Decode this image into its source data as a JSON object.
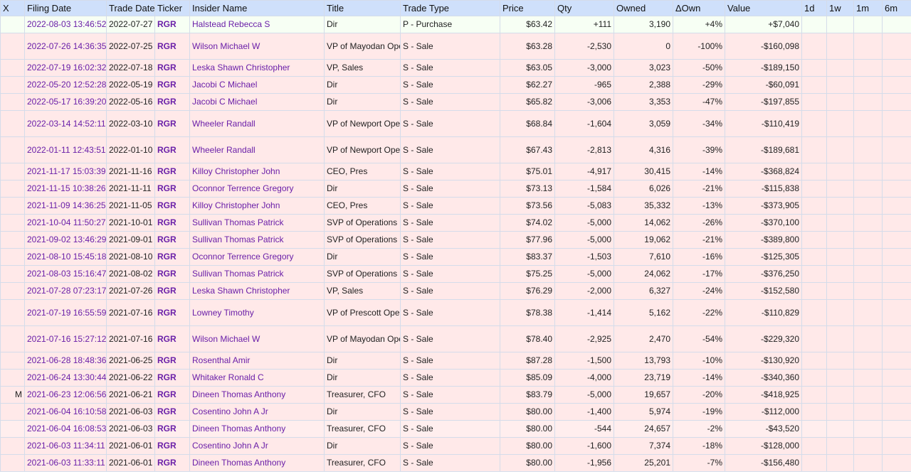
{
  "table": {
    "columns": [
      "X",
      "Filing Date",
      "Trade Date",
      "Ticker",
      "Insider Name",
      "Title",
      "Trade Type",
      "Price",
      "Qty",
      "Owned",
      "ΔOwn",
      "Value",
      "1d",
      "1w",
      "1m",
      "6m"
    ],
    "rows": [
      {
        "x": "",
        "filing_date": "2022-08-03 13:46:52",
        "trade_date": "2022-07-27",
        "ticker": "RGR",
        "insider": "Halstead Rebecca S",
        "title": "Dir",
        "trade_type": "P - Purchase",
        "price": "$63.42",
        "qty": "+111",
        "owned": "3,190",
        "d_own": "+4%",
        "value": "+$7,040",
        "d1": "",
        "w1": "",
        "m1": "",
        "m6": "",
        "kind": "purchase"
      },
      {
        "x": "",
        "filing_date": "2022-07-26 14:36:35",
        "trade_date": "2022-07-25",
        "ticker": "RGR",
        "insider": "Wilson Michael W",
        "title": "VP of Mayodan Operations",
        "trade_type": "S - Sale",
        "price": "$63.28",
        "qty": "-2,530",
        "owned": "0",
        "d_own": "-100%",
        "value": "-$160,098",
        "d1": "",
        "w1": "",
        "m1": "",
        "m6": "",
        "kind": "sale"
      },
      {
        "x": "",
        "filing_date": "2022-07-19 16:02:32",
        "trade_date": "2022-07-18",
        "ticker": "RGR",
        "insider": "Leska Shawn Christopher",
        "title": "VP, Sales",
        "trade_type": "S - Sale",
        "price": "$63.05",
        "qty": "-3,000",
        "owned": "3,023",
        "d_own": "-50%",
        "value": "-$189,150",
        "d1": "",
        "w1": "",
        "m1": "",
        "m6": "",
        "kind": "sale"
      },
      {
        "x": "",
        "filing_date": "2022-05-20 12:52:28",
        "trade_date": "2022-05-19",
        "ticker": "RGR",
        "insider": "Jacobi C Michael",
        "title": "Dir",
        "trade_type": "S - Sale",
        "price": "$62.27",
        "qty": "-965",
        "owned": "2,388",
        "d_own": "-29%",
        "value": "-$60,091",
        "d1": "",
        "w1": "",
        "m1": "",
        "m6": "",
        "kind": "sale"
      },
      {
        "x": "",
        "filing_date": "2022-05-17 16:39:20",
        "trade_date": "2022-05-16",
        "ticker": "RGR",
        "insider": "Jacobi C Michael",
        "title": "Dir",
        "trade_type": "S - Sale",
        "price": "$65.82",
        "qty": "-3,006",
        "owned": "3,353",
        "d_own": "-47%",
        "value": "-$197,855",
        "d1": "",
        "w1": "",
        "m1": "",
        "m6": "",
        "kind": "sale"
      },
      {
        "x": "",
        "filing_date": "2022-03-14 14:52:11",
        "trade_date": "2022-03-10",
        "ticker": "RGR",
        "insider": "Wheeler Randall",
        "title": "VP of Newport Operations",
        "trade_type": "S - Sale",
        "price": "$68.84",
        "qty": "-1,604",
        "owned": "3,059",
        "d_own": "-34%",
        "value": "-$110,419",
        "d1": "",
        "w1": "",
        "m1": "",
        "m6": "",
        "kind": "sale"
      },
      {
        "x": "",
        "filing_date": "2022-01-11 12:43:51",
        "trade_date": "2022-01-10",
        "ticker": "RGR",
        "insider": "Wheeler Randall",
        "title": "VP of Newport Operations",
        "trade_type": "S - Sale",
        "price": "$67.43",
        "qty": "-2,813",
        "owned": "4,316",
        "d_own": "-39%",
        "value": "-$189,681",
        "d1": "",
        "w1": "",
        "m1": "",
        "m6": "",
        "kind": "sale"
      },
      {
        "x": "",
        "filing_date": "2021-11-17 15:03:39",
        "trade_date": "2021-11-16",
        "ticker": "RGR",
        "insider": "Killoy Christopher John",
        "title": "CEO, Pres",
        "trade_type": "S - Sale",
        "price": "$75.01",
        "qty": "-4,917",
        "owned": "30,415",
        "d_own": "-14%",
        "value": "-$368,824",
        "d1": "",
        "w1": "",
        "m1": "",
        "m6": "",
        "kind": "sale"
      },
      {
        "x": "",
        "filing_date": "2021-11-15 10:38:26",
        "trade_date": "2021-11-11",
        "ticker": "RGR",
        "insider": "Oconnor Terrence Gregory",
        "title": "Dir",
        "trade_type": "S - Sale",
        "price": "$73.13",
        "qty": "-1,584",
        "owned": "6,026",
        "d_own": "-21%",
        "value": "-$115,838",
        "d1": "",
        "w1": "",
        "m1": "",
        "m6": "",
        "kind": "sale"
      },
      {
        "x": "",
        "filing_date": "2021-11-09 14:36:25",
        "trade_date": "2021-11-05",
        "ticker": "RGR",
        "insider": "Killoy Christopher John",
        "title": "CEO, Pres",
        "trade_type": "S - Sale",
        "price": "$73.56",
        "qty": "-5,083",
        "owned": "35,332",
        "d_own": "-13%",
        "value": "-$373,905",
        "d1": "",
        "w1": "",
        "m1": "",
        "m6": "",
        "kind": "sale"
      },
      {
        "x": "",
        "filing_date": "2021-10-04 11:50:27",
        "trade_date": "2021-10-01",
        "ticker": "RGR",
        "insider": "Sullivan Thomas Patrick",
        "title": "SVP of Operations",
        "trade_type": "S - Sale",
        "price": "$74.02",
        "qty": "-5,000",
        "owned": "14,062",
        "d_own": "-26%",
        "value": "-$370,100",
        "d1": "",
        "w1": "",
        "m1": "",
        "m6": "",
        "kind": "sale"
      },
      {
        "x": "",
        "filing_date": "2021-09-02 13:46:29",
        "trade_date": "2021-09-01",
        "ticker": "RGR",
        "insider": "Sullivan Thomas Patrick",
        "title": "SVP of Operations",
        "trade_type": "S - Sale",
        "price": "$77.96",
        "qty": "-5,000",
        "owned": "19,062",
        "d_own": "-21%",
        "value": "-$389,800",
        "d1": "",
        "w1": "",
        "m1": "",
        "m6": "",
        "kind": "sale"
      },
      {
        "x": "",
        "filing_date": "2021-08-10 15:45:18",
        "trade_date": "2021-08-10",
        "ticker": "RGR",
        "insider": "Oconnor Terrence Gregory",
        "title": "Dir",
        "trade_type": "S - Sale",
        "price": "$83.37",
        "qty": "-1,503",
        "owned": "7,610",
        "d_own": "-16%",
        "value": "-$125,305",
        "d1": "",
        "w1": "",
        "m1": "",
        "m6": "",
        "kind": "sale"
      },
      {
        "x": "",
        "filing_date": "2021-08-03 15:16:47",
        "trade_date": "2021-08-02",
        "ticker": "RGR",
        "insider": "Sullivan Thomas Patrick",
        "title": "SVP of Operations",
        "trade_type": "S - Sale",
        "price": "$75.25",
        "qty": "-5,000",
        "owned": "24,062",
        "d_own": "-17%",
        "value": "-$376,250",
        "d1": "",
        "w1": "",
        "m1": "",
        "m6": "",
        "kind": "sale"
      },
      {
        "x": "",
        "filing_date": "2021-07-28 07:23:17",
        "trade_date": "2021-07-26",
        "ticker": "RGR",
        "insider": "Leska Shawn Christopher",
        "title": "VP, Sales",
        "trade_type": "S - Sale",
        "price": "$76.29",
        "qty": "-2,000",
        "owned": "6,327",
        "d_own": "-24%",
        "value": "-$152,580",
        "d1": "",
        "w1": "",
        "m1": "",
        "m6": "",
        "kind": "sale"
      },
      {
        "x": "",
        "filing_date": "2021-07-19 16:55:59",
        "trade_date": "2021-07-16",
        "ticker": "RGR",
        "insider": "Lowney Timothy",
        "title": "VP of Prescott Operations",
        "trade_type": "S - Sale",
        "price": "$78.38",
        "qty": "-1,414",
        "owned": "5,162",
        "d_own": "-22%",
        "value": "-$110,829",
        "d1": "",
        "w1": "",
        "m1": "",
        "m6": "",
        "kind": "sale"
      },
      {
        "x": "",
        "filing_date": "2021-07-16 15:27:12",
        "trade_date": "2021-07-16",
        "ticker": "RGR",
        "insider": "Wilson Michael W",
        "title": "VP of Mayodan Operations",
        "trade_type": "S - Sale",
        "price": "$78.40",
        "qty": "-2,925",
        "owned": "2,470",
        "d_own": "-54%",
        "value": "-$229,320",
        "d1": "",
        "w1": "",
        "m1": "",
        "m6": "",
        "kind": "sale"
      },
      {
        "x": "",
        "filing_date": "2021-06-28 18:48:36",
        "trade_date": "2021-06-25",
        "ticker": "RGR",
        "insider": "Rosenthal Amir",
        "title": "Dir",
        "trade_type": "S - Sale",
        "price": "$87.28",
        "qty": "-1,500",
        "owned": "13,793",
        "d_own": "-10%",
        "value": "-$130,920",
        "d1": "",
        "w1": "",
        "m1": "",
        "m6": "",
        "kind": "sale"
      },
      {
        "x": "",
        "filing_date": "2021-06-24 13:30:44",
        "trade_date": "2021-06-22",
        "ticker": "RGR",
        "insider": "Whitaker Ronald C",
        "title": "Dir",
        "trade_type": "S - Sale",
        "price": "$85.09",
        "qty": "-4,000",
        "owned": "23,719",
        "d_own": "-14%",
        "value": "-$340,360",
        "d1": "",
        "w1": "",
        "m1": "",
        "m6": "",
        "kind": "sale"
      },
      {
        "x": "M",
        "filing_date": "2021-06-23 12:06:56",
        "trade_date": "2021-06-21",
        "ticker": "RGR",
        "insider": "Dineen Thomas Anthony",
        "title": "Treasurer, CFO",
        "trade_type": "S - Sale",
        "price": "$83.79",
        "qty": "-5,000",
        "owned": "19,657",
        "d_own": "-20%",
        "value": "-$418,925",
        "d1": "",
        "w1": "",
        "m1": "",
        "m6": "",
        "kind": "sale"
      },
      {
        "x": "",
        "filing_date": "2021-06-04 16:10:58",
        "trade_date": "2021-06-03",
        "ticker": "RGR",
        "insider": "Cosentino John A Jr",
        "title": "Dir",
        "trade_type": "S - Sale",
        "price": "$80.00",
        "qty": "-1,400",
        "owned": "5,974",
        "d_own": "-19%",
        "value": "-$112,000",
        "d1": "",
        "w1": "",
        "m1": "",
        "m6": "",
        "kind": "sale"
      },
      {
        "x": "",
        "filing_date": "2021-06-04 16:08:53",
        "trade_date": "2021-06-03",
        "ticker": "RGR",
        "insider": "Dineen Thomas Anthony",
        "title": "Treasurer, CFO",
        "trade_type": "S - Sale",
        "price": "$80.00",
        "qty": "-544",
        "owned": "24,657",
        "d_own": "-2%",
        "value": "-$43,520",
        "d1": "",
        "w1": "",
        "m1": "",
        "m6": "",
        "kind": "sale-alt"
      },
      {
        "x": "",
        "filing_date": "2021-06-03 11:34:11",
        "trade_date": "2021-06-01",
        "ticker": "RGR",
        "insider": "Cosentino John A Jr",
        "title": "Dir",
        "trade_type": "S - Sale",
        "price": "$80.00",
        "qty": "-1,600",
        "owned": "7,374",
        "d_own": "-18%",
        "value": "-$128,000",
        "d1": "",
        "w1": "",
        "m1": "",
        "m6": "",
        "kind": "sale"
      },
      {
        "x": "",
        "filing_date": "2021-06-03 11:33:11",
        "trade_date": "2021-06-01",
        "ticker": "RGR",
        "insider": "Dineen Thomas Anthony",
        "title": "Treasurer, CFO",
        "trade_type": "S - Sale",
        "price": "$80.00",
        "qty": "-1,956",
        "owned": "25,201",
        "d_own": "-7%",
        "value": "-$156,480",
        "d1": "",
        "w1": "",
        "m1": "",
        "m6": "",
        "kind": "sale"
      }
    ]
  },
  "colors": {
    "header_bg": "#cfe0fb",
    "purchase_row_bg": "#f7fff4",
    "sale_row_bg": "#ffe9e9",
    "link": "#6a1fa8",
    "grid": "#d4dcea"
  }
}
